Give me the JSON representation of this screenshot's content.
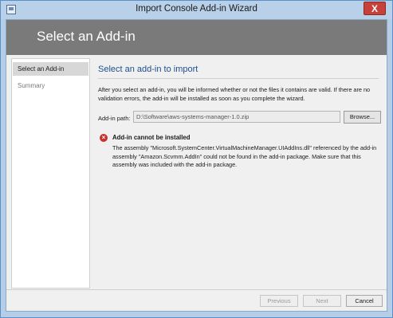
{
  "window": {
    "title": "Import Console Add-in Wizard",
    "close_glyph": "X"
  },
  "banner": {
    "title": "Select an Add-in"
  },
  "nav": {
    "items": [
      {
        "label": "Select an Add-in",
        "active": true
      },
      {
        "label": "Summary",
        "active": false
      }
    ]
  },
  "content": {
    "heading": "Select an add-in to import",
    "description": "After you select an add-in, you will be informed whether or not the files it contains are valid. If there are no validation errors, the add-in will be installed as soon as you complete the wizard.",
    "path_label": "Add-in path:",
    "path_value": "D:\\Software\\aws-systems-manager-1.0.zip",
    "browse_label": "Browse...",
    "error": {
      "icon": "error-x-icon",
      "icon_glyph": "×",
      "title": "Add-in cannot be installed",
      "body": "The assembly \"Microsoft.SystemCenter.VirtualMachineManager.UIAddIns.dll\" referenced by the add-in assembly \"Amazon.Scvmm.AddIn\" could not be found in the add-in package. Make sure that this assembly was included with the add-in package."
    }
  },
  "footer": {
    "previous_label": "Previous",
    "next_label": "Next",
    "cancel_label": "Cancel"
  },
  "colors": {
    "frame": "#b9d0e9",
    "banner": "#7a7a7a",
    "heading": "#1f4e8c",
    "close": "#c7403a",
    "error": "#c9302c"
  }
}
